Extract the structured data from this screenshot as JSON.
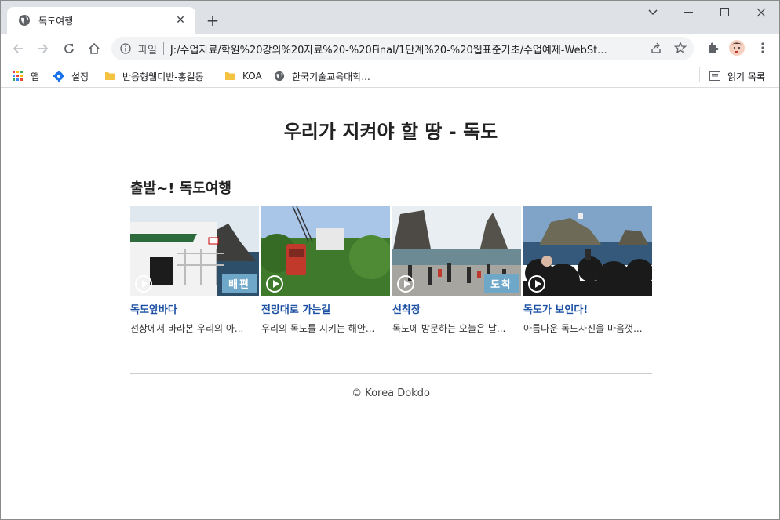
{
  "browser": {
    "tab_title": "독도여행",
    "new_tab": "+",
    "address_scheme": "파일",
    "address_url": "J:/수업자료/학원%20강의%20자료%20-%20Final/1단계%20-%20웹표준기초/수업예제-WebSt...",
    "bookmarks": [
      "앱",
      "설정",
      "반응형웹디반-홍길동",
      "KOA",
      "한국기술교육대학..."
    ],
    "reading_list": "읽기 목록"
  },
  "page": {
    "title": "우리가 지켜야 할 땅 - 독도",
    "section_title": "출발~! 독도여행",
    "cards": [
      {
        "title": "독도앞바다",
        "desc": "선상에서 바라본 우리의 아...",
        "badge": "배편"
      },
      {
        "title": "전망대로 가는길",
        "desc": "우리의 독도를 지키는 해안...",
        "badge": ""
      },
      {
        "title": "선착장",
        "desc": "독도에 방문하는 오늘은 날...",
        "badge": "도착"
      },
      {
        "title": "독도가 보인다!",
        "desc": "아름다운 독도사진을 마음껏...",
        "badge": ""
      }
    ],
    "footer": "© Korea Dokdo"
  },
  "colors": {
    "tabstrip": "#dee1e6",
    "link": "#1a4fa3",
    "badge": "#6fa7c9"
  }
}
